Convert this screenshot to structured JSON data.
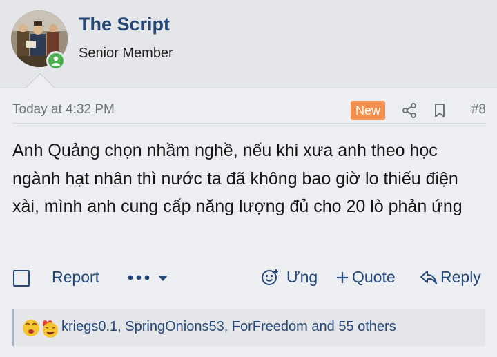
{
  "user": {
    "name": "The Script",
    "title": "Senior Member",
    "online": true
  },
  "post": {
    "timestamp": "Today at 4:32 PM",
    "badge": "New",
    "number": "#8",
    "body": "Anh Quảng chọn nhầm nghề, nếu khi xưa anh theo học ngành hạt nhân thì nước ta đã không bao giờ lo thiếu điện xài, mình anh cung cấp năng lượng đủ cho 20 lò phản ứng"
  },
  "actions": {
    "report": "Report",
    "react": "Ưng",
    "quote": "Quote",
    "reply": "Reply"
  },
  "reactions": {
    "summary": "kriegs0.1, SpringOnions53, ForFreedom and 55 others"
  },
  "colors": {
    "link": "#24487a",
    "badge": "#f3904e",
    "online": "#4caf50"
  }
}
